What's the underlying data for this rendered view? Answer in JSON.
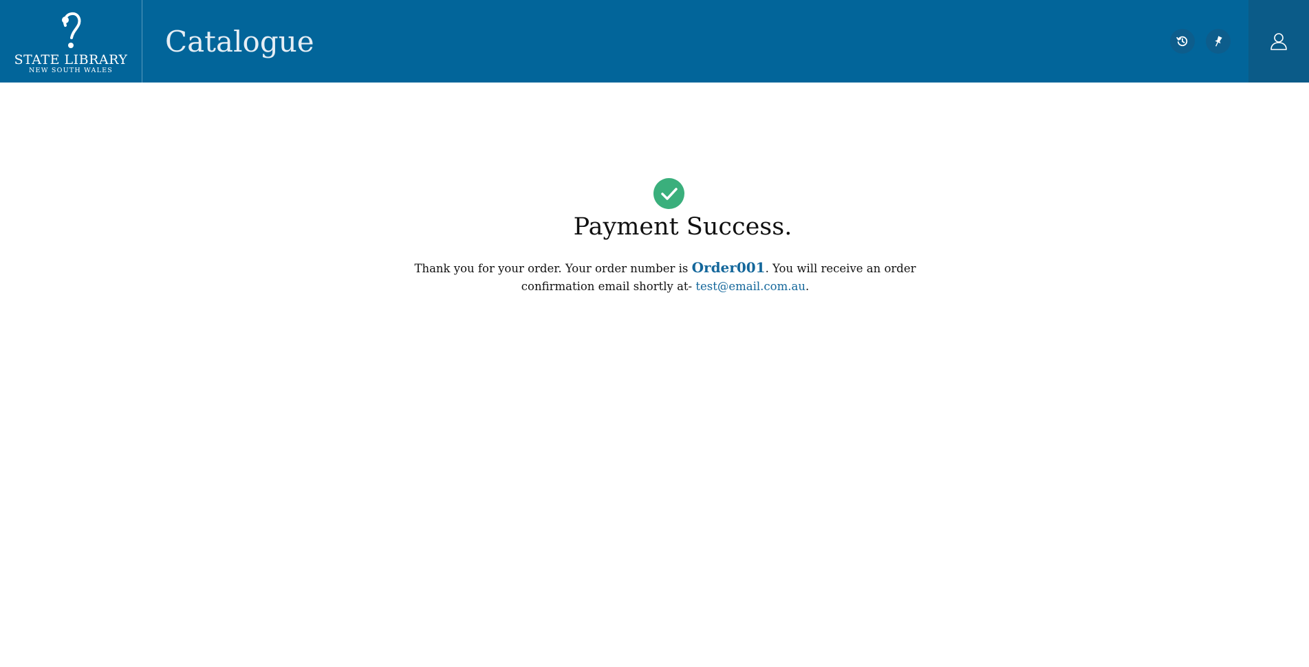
{
  "header": {
    "logo": {
      "main": "STATE LIBRARY",
      "sub": "NEW SOUTH WALES"
    },
    "title": "Catalogue",
    "icons": {
      "history": "history-icon",
      "pin": "pin-icon",
      "account": "user-icon"
    }
  },
  "content": {
    "heading": "Payment Success.",
    "message_before": "Thank you for your order. Your order number is ",
    "order_number": "Order001",
    "message_middle": ". You will receive an order confirmation email shortly at- ",
    "email": "test@email.com.au",
    "message_end": "."
  },
  "colors": {
    "header_bg": "#02659a",
    "success": "#3aaf7c",
    "link": "#14679b"
  }
}
